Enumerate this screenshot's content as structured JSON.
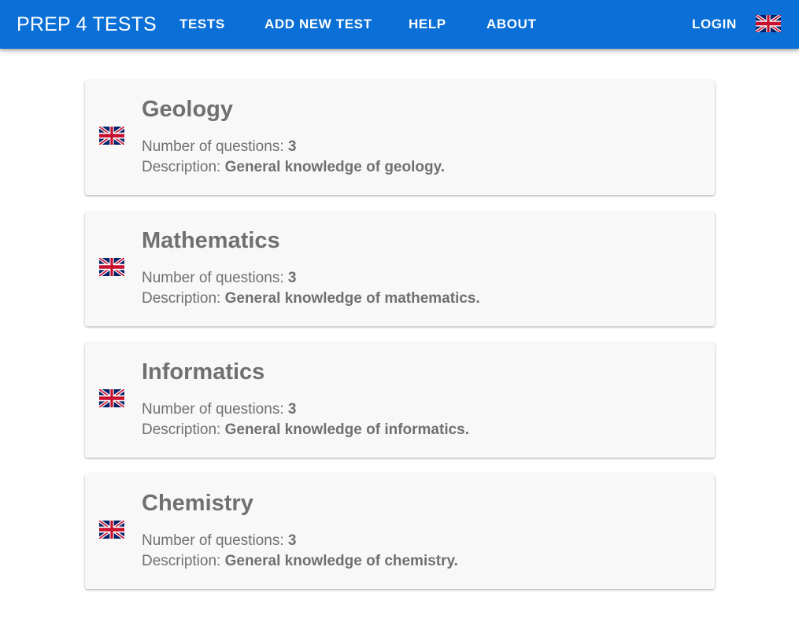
{
  "header": {
    "brand": "PREP 4 TESTS",
    "nav": {
      "tests": "TESTS",
      "add_new_test": "ADD NEW TEST",
      "help": "HELP",
      "about": "ABOUT",
      "login": "LOGIN"
    },
    "language_icon": "uk-flag-icon"
  },
  "labels": {
    "questions": "Number of questions: ",
    "description": "Description: "
  },
  "tests": [
    {
      "title": "Geology",
      "questions": "3",
      "description": "General knowledge of geology.",
      "flag_icon": "uk-flag-icon"
    },
    {
      "title": "Mathematics",
      "questions": "3",
      "description": "General knowledge of mathematics.",
      "flag_icon": "uk-flag-icon"
    },
    {
      "title": "Informatics",
      "questions": "3",
      "description": "General knowledge of informatics.",
      "flag_icon": "uk-flag-icon"
    },
    {
      "title": "Chemistry",
      "questions": "3",
      "description": "General knowledge of chemistry.",
      "flag_icon": "uk-flag-icon"
    }
  ],
  "colors": {
    "appbar": "#0a6fd6",
    "card_background": "#f8f8f8",
    "text": "#707070"
  }
}
